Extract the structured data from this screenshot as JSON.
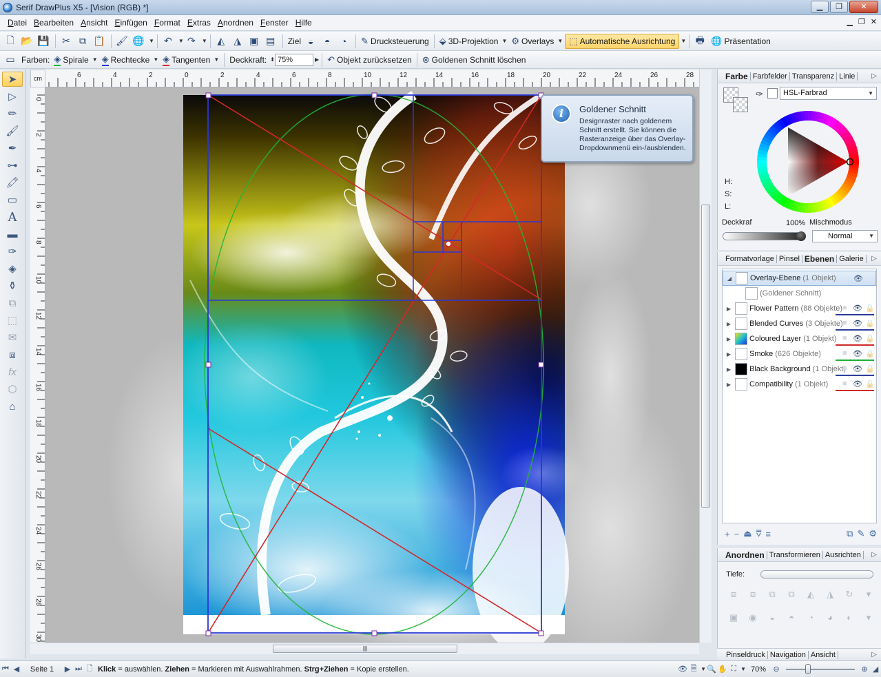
{
  "window": {
    "title": "Serif DrawPlus X5 - [Vision (RGB) *]",
    "minimize": "▁",
    "maximize": "❐",
    "close": "✕"
  },
  "menu": [
    "Datei",
    "Bearbeiten",
    "Ansicht",
    "Einfügen",
    "Format",
    "Extras",
    "Anordnen",
    "Fenster",
    "Hilfe"
  ],
  "toolbar1": {
    "target_label": "Ziel",
    "print_control": "Drucksteuerung",
    "projection_3d": "3D-Projektion",
    "overlays": "Overlays",
    "auto_align": "Automatische Ausrichtung",
    "presentation": "Präsentation"
  },
  "toolbar2": {
    "colors_label": "Farben:",
    "spiral": "Spirale",
    "rectangles": "Rechtecke",
    "tangents": "Tangenten",
    "opacity_label": "Deckkraft:",
    "opacity_value": "75%",
    "reset_object": "Objekt zurücksetzen",
    "delete_golden": "Goldenen Schnitt löschen"
  },
  "ruler": {
    "unit": "cm",
    "h_labels": [
      "6",
      "4",
      "2",
      "0",
      "2",
      "4",
      "6",
      "8",
      "10",
      "12",
      "14",
      "16",
      "18",
      "20",
      "22",
      "24",
      "26",
      "28"
    ],
    "v_labels": [
      "0",
      "2",
      "4",
      "6",
      "8",
      "10",
      "12",
      "14",
      "16",
      "18",
      "20",
      "22",
      "24",
      "26",
      "28",
      "30"
    ]
  },
  "tooltip": {
    "title": "Goldener Schnitt",
    "body": "Designraster nach goldenem Schnitt erstellt. Sie können die Rasteranzeige über das Overlay-Dropdownmenü ein-/ausblenden.",
    "icon": "info-icon"
  },
  "color_panel": {
    "tabs": [
      "Farbe",
      "Farbfelder",
      "Transparenz",
      "Linie"
    ],
    "model": "HSL-Farbrad",
    "h_label": "H:",
    "s_label": "S:",
    "l_label": "L:",
    "opacity_label": "Deckkraf",
    "opacity_value": "100%",
    "blend_label": "Mischmodus",
    "blend_value": "Normal"
  },
  "layers_panel": {
    "tabs": [
      "Formatvorlage",
      "Pinsel",
      "Ebenen",
      "Galerie"
    ],
    "layers": [
      {
        "name": "Overlay-Ebene",
        "count": "(1 Objekt)",
        "expander": "◢",
        "selected": true
      },
      {
        "name": "(Goldener Schnitt)",
        "count": "",
        "expander": "",
        "child": true
      },
      {
        "name": "Flower Pattern",
        "count": "(88 Objekte)",
        "expander": "▶",
        "line": "#2c3c9c"
      },
      {
        "name": "Blended Curves",
        "count": "(3 Objekte)",
        "expander": "▶",
        "line": "#2c3c9c"
      },
      {
        "name": "Coloured Layer",
        "count": "(1 Objekt)",
        "expander": "▶",
        "line": "#d02828"
      },
      {
        "name": "Smoke",
        "count": "(626 Objekte)",
        "expander": "▶",
        "line": "#1fb03a"
      },
      {
        "name": "Black Background",
        "count": "(1 Objekt)",
        "expander": "▶",
        "line": "#2c3c9c"
      },
      {
        "name": "Compatibility",
        "count": "(1 Objekt)",
        "expander": "▶",
        "line": "#d02828"
      }
    ]
  },
  "arrange_panel": {
    "tabs": [
      "Anordnen",
      "Transformieren",
      "Ausrichten"
    ],
    "depth_label": "Tiefe:"
  },
  "bottom_tabs": [
    "Pinseldruck",
    "Navigation",
    "Ansicht"
  ],
  "status": {
    "page": "Seite 1",
    "hint_click": "Klick",
    "hint_click_text": " = auswählen. ",
    "hint_drag": "Ziehen",
    "hint_drag_text": " = Markieren mit  Auswahlrahmen. ",
    "hint_copy": "Strg+Ziehen",
    "hint_copy_text": " = Kopie erstellen.",
    "zoom": "70%"
  },
  "colors": {
    "spiral": "#21b536",
    "rectangles": "#2838d4",
    "tangents": "#d42828",
    "accent": "#ffd46a"
  }
}
